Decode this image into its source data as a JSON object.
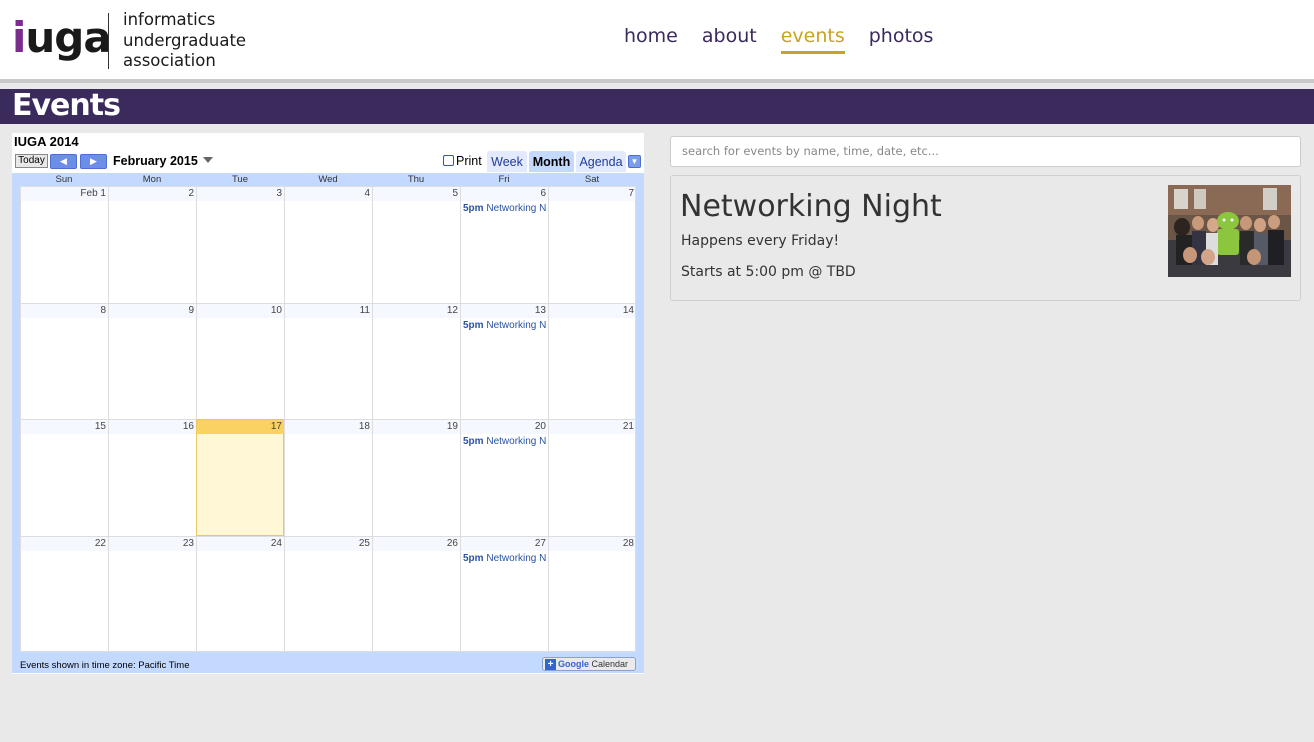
{
  "header": {
    "logo_mark": "iuga",
    "logo_lines": [
      "informatics",
      "undergraduate",
      "association"
    ],
    "nav": [
      {
        "label": "home",
        "active": false
      },
      {
        "label": "about",
        "active": false
      },
      {
        "label": "events",
        "active": true
      },
      {
        "label": "photos",
        "active": false
      }
    ]
  },
  "page": {
    "title": "Events"
  },
  "calendar": {
    "title": "IUGA 2014",
    "today_button": "Today",
    "prev_icon": "chevron-left-icon",
    "next_icon": "chevron-right-icon",
    "month_label": "February 2015",
    "print_label": "Print",
    "tabs": [
      {
        "label": "Week",
        "selected": false
      },
      {
        "label": "Month",
        "selected": true
      },
      {
        "label": "Agenda",
        "selected": false
      }
    ],
    "weekdays": [
      "Sun",
      "Mon",
      "Tue",
      "Wed",
      "Thu",
      "Fri",
      "Sat"
    ],
    "weeks": [
      [
        "Feb 1",
        "2",
        "3",
        "4",
        "5",
        "6",
        "7"
      ],
      [
        "8",
        "9",
        "10",
        "11",
        "12",
        "13",
        "14"
      ],
      [
        "15",
        "16",
        "17",
        "18",
        "19",
        "20",
        "21"
      ],
      [
        "22",
        "23",
        "24",
        "25",
        "26",
        "27",
        "28"
      ]
    ],
    "today": "17",
    "event_time": "5pm",
    "event_title": "Networking N",
    "event_dates": [
      "6",
      "13",
      "20",
      "27"
    ],
    "footer_text": "Events shown in time zone: Pacific Time",
    "gcal_button": {
      "google": "Google",
      "calendar": "Calendar"
    }
  },
  "search": {
    "placeholder": "search for events by name, time, date, etc..."
  },
  "event_card": {
    "title": "Networking Night",
    "recurrence": "Happens every Friday!",
    "details": "Starts at 5:00 pm @ TBD"
  },
  "colors": {
    "brand_purple": "#3b2a5c",
    "accent_gold": "#c9a227",
    "logo_i": "#7b2d8e"
  }
}
